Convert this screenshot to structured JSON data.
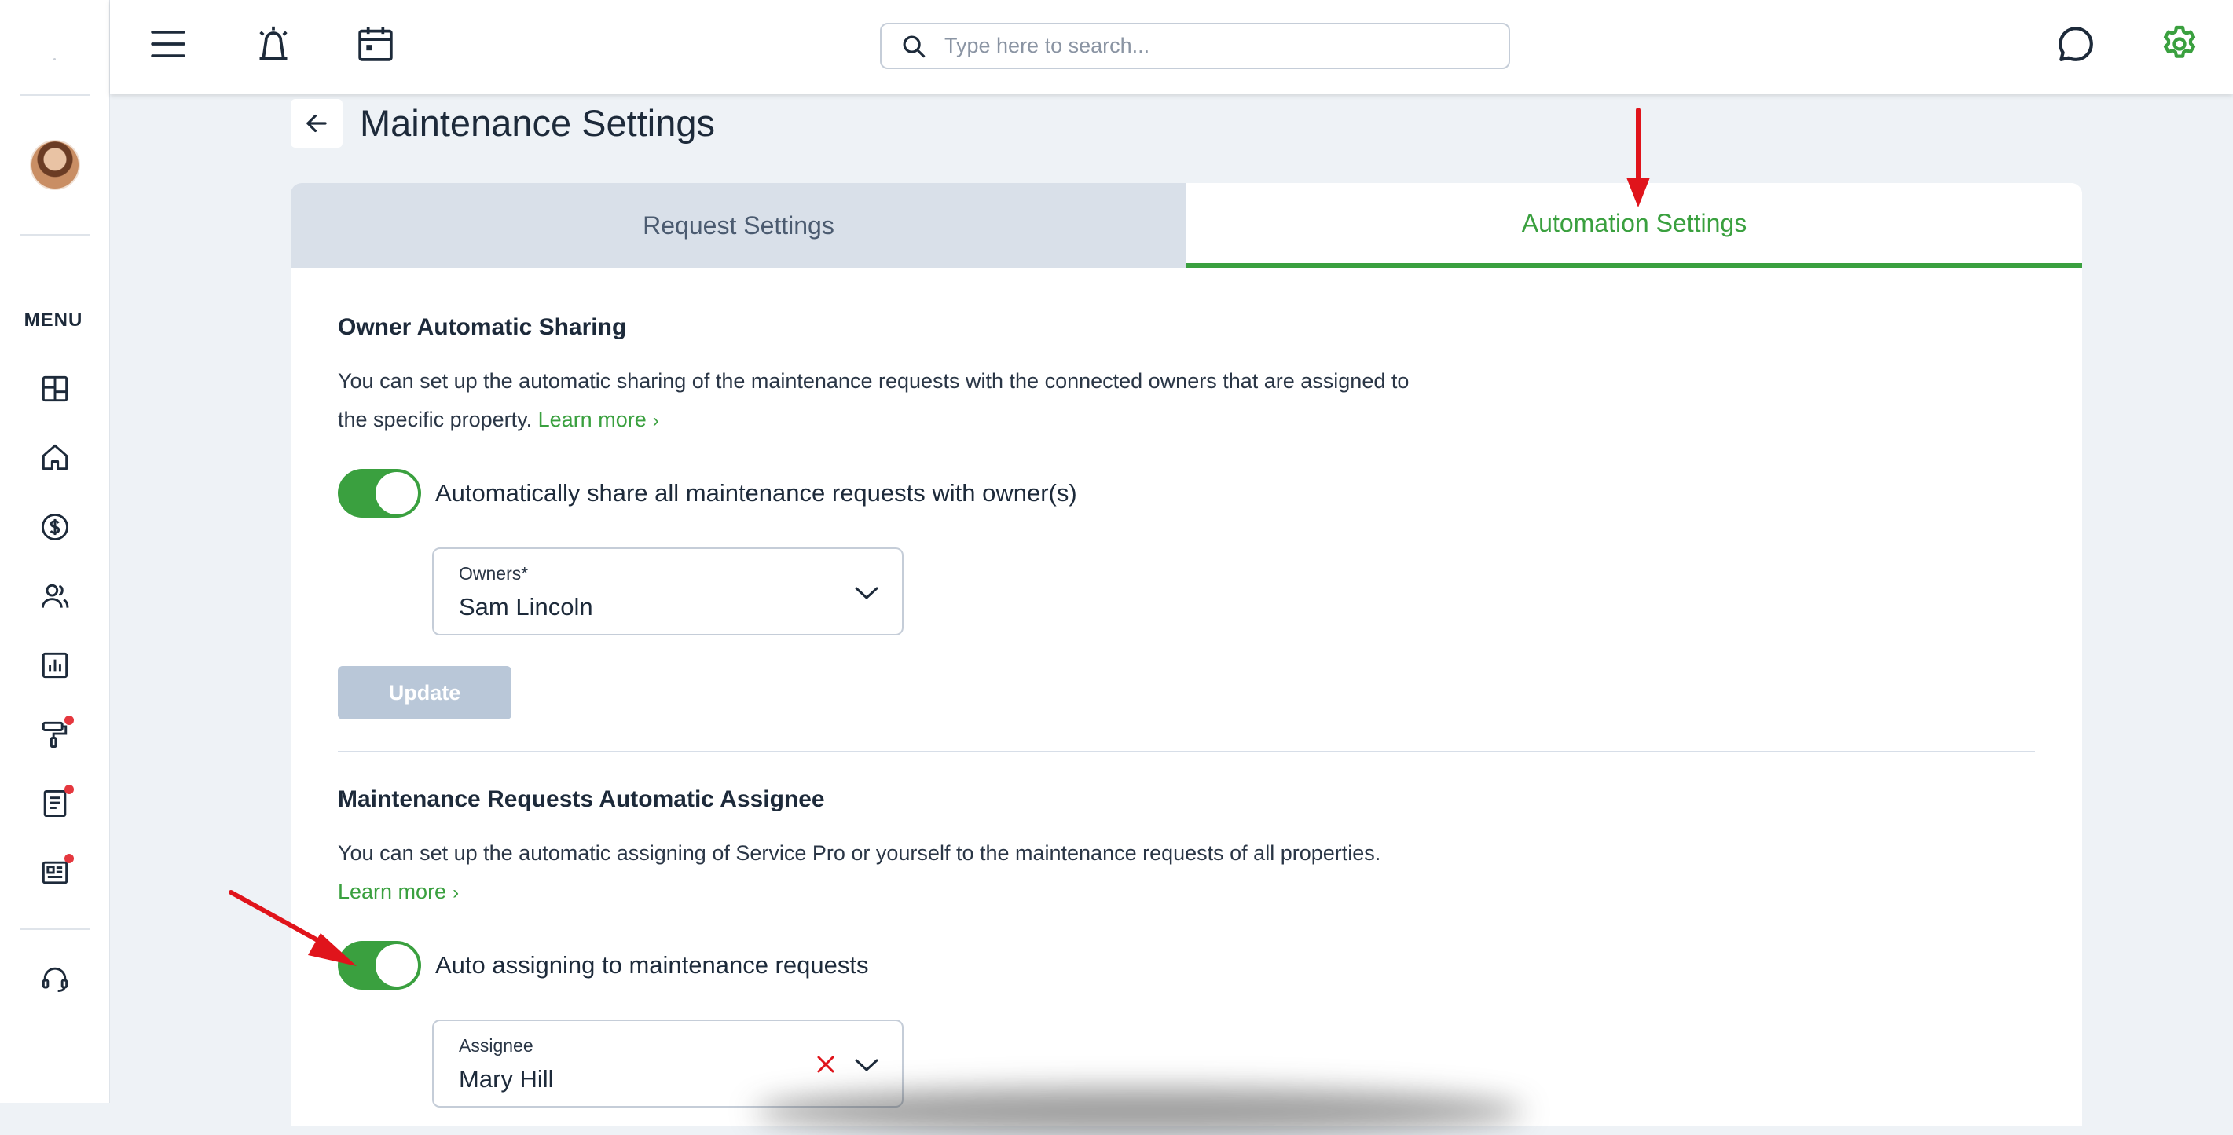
{
  "sidebar": {
    "menu_label": "MENU",
    "items": [
      {
        "icon": "dashboard-icon",
        "badge": false
      },
      {
        "icon": "home-icon",
        "badge": false
      },
      {
        "icon": "dollar-icon",
        "badge": false
      },
      {
        "icon": "people-icon",
        "badge": false
      },
      {
        "icon": "chart-icon",
        "badge": false
      },
      {
        "icon": "paint-roller-icon",
        "badge": true
      },
      {
        "icon": "document-icon",
        "badge": true
      },
      {
        "icon": "news-icon",
        "badge": true
      }
    ],
    "support_icon": "headset-icon"
  },
  "topbar": {
    "search_placeholder": "Type here to search..."
  },
  "page": {
    "title": "Maintenance Settings"
  },
  "tabs": [
    {
      "label": "Request Settings",
      "active": false
    },
    {
      "label": "Automation Settings",
      "active": true
    }
  ],
  "owner_sharing": {
    "title": "Owner Automatic Sharing",
    "description_line1": "You can set up the automatic sharing of the maintenance requests with the connected owners that are assigned to",
    "description_line2": "the specific property.",
    "learn_more": "Learn more",
    "toggle_label": "Automatically share all maintenance requests with owner(s)",
    "toggle_on": true,
    "owners_label": "Owners*",
    "owners_value": "Sam Lincoln",
    "update_label": "Update"
  },
  "auto_assignee": {
    "title": "Maintenance Requests Automatic Assignee",
    "description": "You can set up the automatic assigning of Service Pro or yourself to the maintenance requests of all properties.",
    "learn_more": "Learn more",
    "toggle_label": "Auto assigning to maintenance requests",
    "toggle_on": true,
    "assignee_label": "Assignee",
    "assignee_value": "Mary Hill"
  },
  "colors": {
    "accent": "#3aa03f",
    "annotation": "#e0141b",
    "badge": "#e5373e"
  }
}
